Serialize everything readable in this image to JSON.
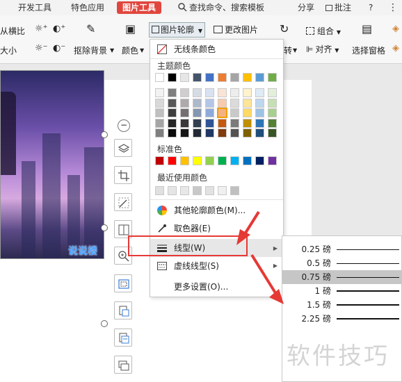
{
  "tabs": {
    "dev_tools": "开发工具",
    "special_app": "特色应用",
    "picture_tools": "图片工具",
    "search": "查找命令、搜索模板",
    "share": "分享",
    "annotate": "批注",
    "help": "?"
  },
  "ribbon": {
    "from_ratio": "从横比",
    "size": "大小",
    "remove_bg": "抠除背景",
    "color": "颜色",
    "picture_outline": "图片轮廓",
    "change_picture": "更改图片",
    "rotate": "转",
    "group": "组合",
    "align": "对齐",
    "selection_pane": "选择窗格"
  },
  "colors": {
    "accent_red": "#e1463e",
    "highlight_red": "#e53935"
  },
  "dropdown": {
    "no_outline": "无线条颜色",
    "theme_colors_label": "主题颜色",
    "standard_colors_label": "标准色",
    "recent_colors_label": "最近使用颜色",
    "more_colors": "其他轮廓颜色(M)...",
    "eyedropper": "取色器(E)",
    "line_type": "线型(W)",
    "dash_type": "虚线线型(S)",
    "more_settings": "更多设置(O)...",
    "theme_top_row": [
      "#ffffff",
      "#000000",
      "#e7e6e6",
      "#44546a",
      "#4472c4",
      "#ed7d31",
      "#a5a5a5",
      "#ffc000",
      "#5b9bd5",
      "#70ad47"
    ],
    "theme_shades": [
      [
        "#f2f2f2",
        "#7f7f7f",
        "#d0cece",
        "#d6dce4",
        "#d9e2f3",
        "#fbe4d5",
        "#ededed",
        "#fff2cc",
        "#deebf6",
        "#e2efd9"
      ],
      [
        "#d8d8d8",
        "#595959",
        "#aeaaaa",
        "#adb9ca",
        "#b4c6e7",
        "#f7cbac",
        "#dbdbdb",
        "#ffe598",
        "#bdd7ee",
        "#c5e0b3"
      ],
      [
        "#bfbfbf",
        "#3f3f3f",
        "#757070",
        "#8496b0",
        "#8eaadb",
        "#f4b183",
        "#c9c9c9",
        "#ffd965",
        "#9cc3e5",
        "#a8d08d"
      ],
      [
        "#a5a5a5",
        "#262626",
        "#3a3838",
        "#323f4f",
        "#2f5496",
        "#c55a11",
        "#7b7b7b",
        "#bf8f00",
        "#2e75b5",
        "#538135"
      ],
      [
        "#7f7f7f",
        "#0c0c0c",
        "#171616",
        "#222a35",
        "#1f3864",
        "#833c0b",
        "#525252",
        "#7f6000",
        "#1e4e79",
        "#375623"
      ]
    ],
    "standard": [
      "#c00000",
      "#ff0000",
      "#ffc000",
      "#ffff00",
      "#92d050",
      "#00b050",
      "#00b0f0",
      "#0070c0",
      "#002060",
      "#7030a0"
    ],
    "recent": [
      "#e0e0e0",
      "#e5e5e5",
      "#e8e8e8",
      "#c8c8c8",
      "#e2e2e2",
      "#f0f0f0",
      "#c0c0c0"
    ]
  },
  "submenu": {
    "unit": "磅",
    "weights": [
      "0.25",
      "0.5",
      "0.75",
      "1",
      "1.5",
      "2.25"
    ],
    "selected": "0.75"
  },
  "watermarks": {
    "photo": "说说楼",
    "corner": "软件技巧"
  }
}
